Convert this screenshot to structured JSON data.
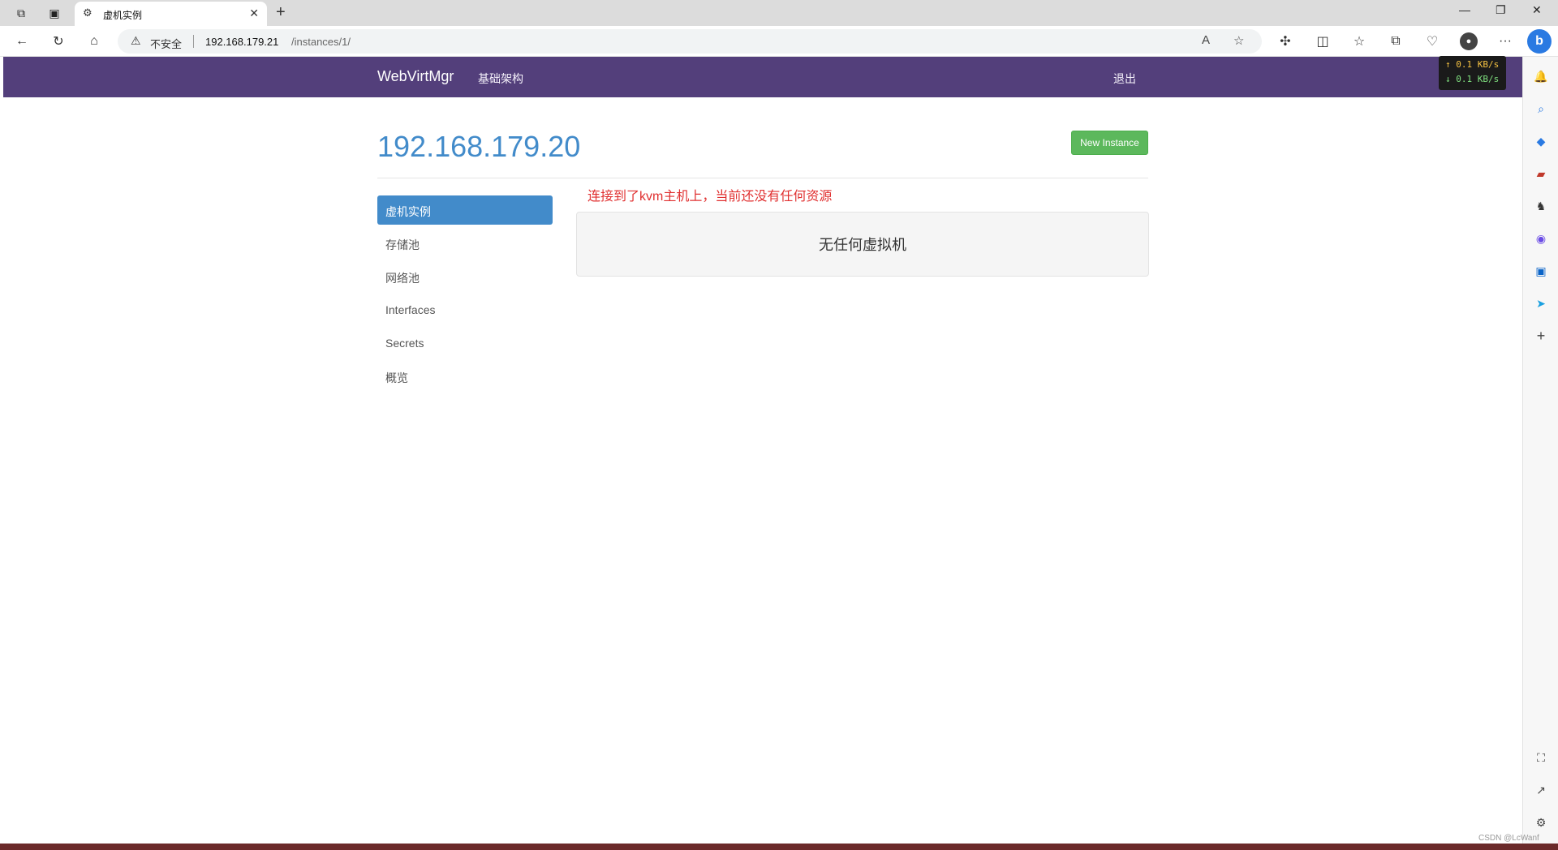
{
  "browser": {
    "tab": {
      "title": "虚机实例"
    },
    "address": {
      "security_label": "不安全",
      "url_host": "192.168.179.21",
      "url_path": "/instances/1/"
    }
  },
  "net_speed": {
    "up": "↑ 0.1 KB/s",
    "down": "↓ 0.1 KB/s"
  },
  "navbar": {
    "brand": "WebVirtMgr",
    "infrastructure": "基础架构",
    "logout": "退出"
  },
  "main": {
    "host_title": "192.168.179.20",
    "new_instance_button": "New Instance",
    "notice": "连接到了kvm主机上，当前还没有任何资源",
    "empty_message": "无任何虚拟机"
  },
  "sidebar": {
    "items": [
      {
        "label": "虚机实例",
        "active": true
      },
      {
        "label": "存储池",
        "active": false
      },
      {
        "label": "网络池",
        "active": false
      },
      {
        "label": "Interfaces",
        "active": false
      },
      {
        "label": "Secrets",
        "active": false
      },
      {
        "label": "概览",
        "active": false
      }
    ]
  },
  "watermark": "CSDN @LcWanf",
  "colors": {
    "navbar": "#533f7b",
    "primary": "#428bca",
    "success": "#5cb85c",
    "notice": "#e03030"
  }
}
